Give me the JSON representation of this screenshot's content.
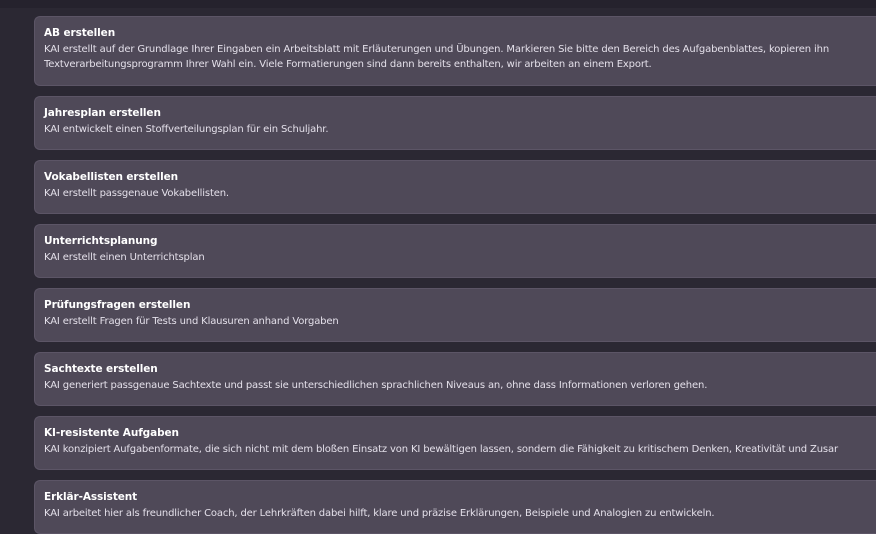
{
  "cards": [
    {
      "title": "AB erstellen",
      "desc_line1": "KAI erstellt auf der Grundlage Ihrer Eingaben ein Arbeitsblatt mit Erläuterungen und Übungen. Markieren Sie bitte den Bereich des Aufgabenblattes, kopieren ihn",
      "desc_line2": "Textverarbeitungsprogramm Ihrer Wahl ein. Viele Formatierungen sind dann bereits enthalten, wir arbeiten an einem Export."
    },
    {
      "title": "Jahresplan erstellen",
      "desc": "KAI entwickelt einen Stoffverteilungsplan für ein Schuljahr."
    },
    {
      "title": "Vokabellisten erstellen",
      "desc": "KAI erstellt passgenaue Vokabellisten."
    },
    {
      "title": "Unterrichtsplanung",
      "desc": "KAI erstellt einen Unterrichtsplan"
    },
    {
      "title": "Prüfungsfragen erstellen",
      "desc": "KAI erstellt Fragen für Tests und Klausuren anhand Vorgaben"
    },
    {
      "title": "Sachtexte erstellen",
      "desc": "KAI generiert passgenaue Sachtexte und passt sie unterschiedlichen sprachlichen Niveaus an, ohne dass Informationen verloren gehen."
    },
    {
      "title": "KI-resistente Aufgaben",
      "desc": "KAI konzipiert Aufgabenformate, die sich nicht mit dem bloßen Einsatz von KI bewältigen lassen, sondern die Fähigkeit zu kritischem Denken, Kreativität und Zusar"
    },
    {
      "title": "Erklär-Assistent",
      "desc": "KAI arbeitet hier als freundlicher Coach, der Lehrkräften dabei hilft, klare und präzise Erklärungen, Beispiele und Analogien zu entwickeln."
    }
  ]
}
